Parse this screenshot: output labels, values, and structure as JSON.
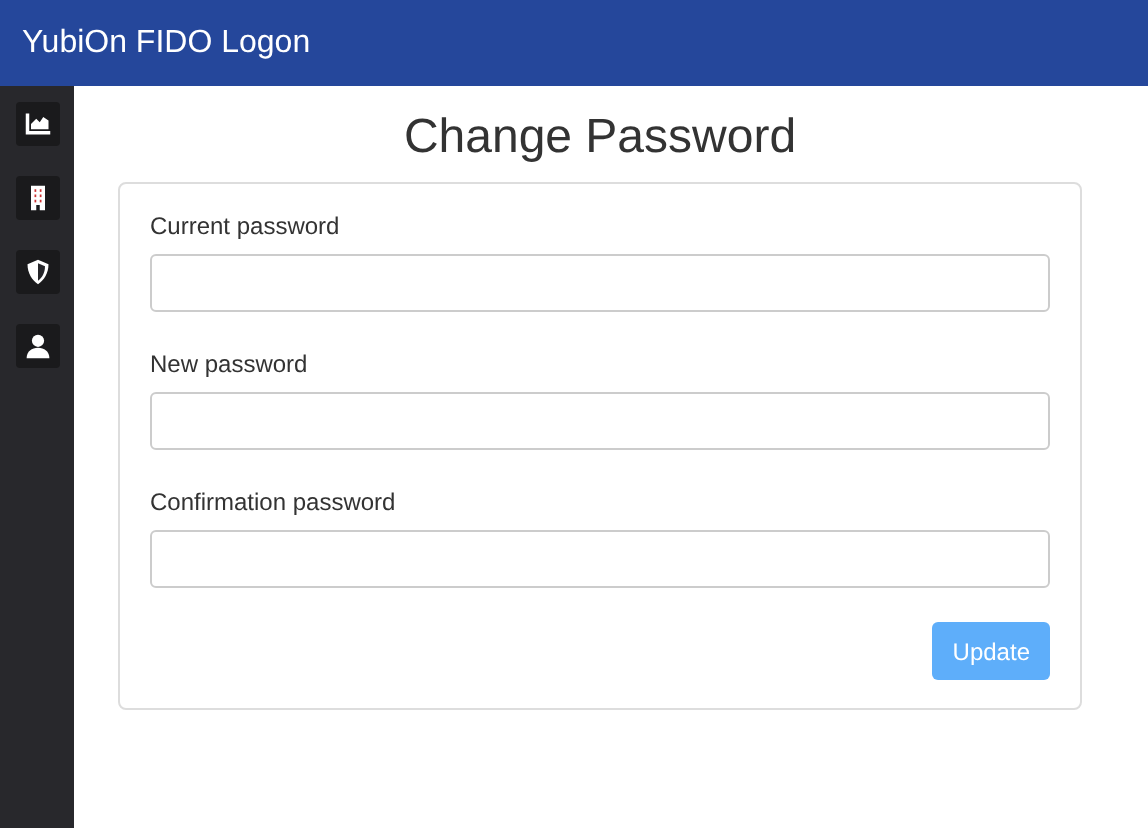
{
  "header": {
    "title": "YubiOn FIDO Logon"
  },
  "sidebar": {
    "items": [
      {
        "kind": "chart"
      },
      {
        "kind": "building"
      },
      {
        "kind": "shield"
      },
      {
        "kind": "user"
      }
    ]
  },
  "page": {
    "title": "Change Password"
  },
  "form": {
    "fields": [
      {
        "label": "Current password"
      },
      {
        "label": "New password"
      },
      {
        "label": "Confirmation password"
      }
    ],
    "submit": {
      "label": "Update",
      "disabled": true
    }
  }
}
